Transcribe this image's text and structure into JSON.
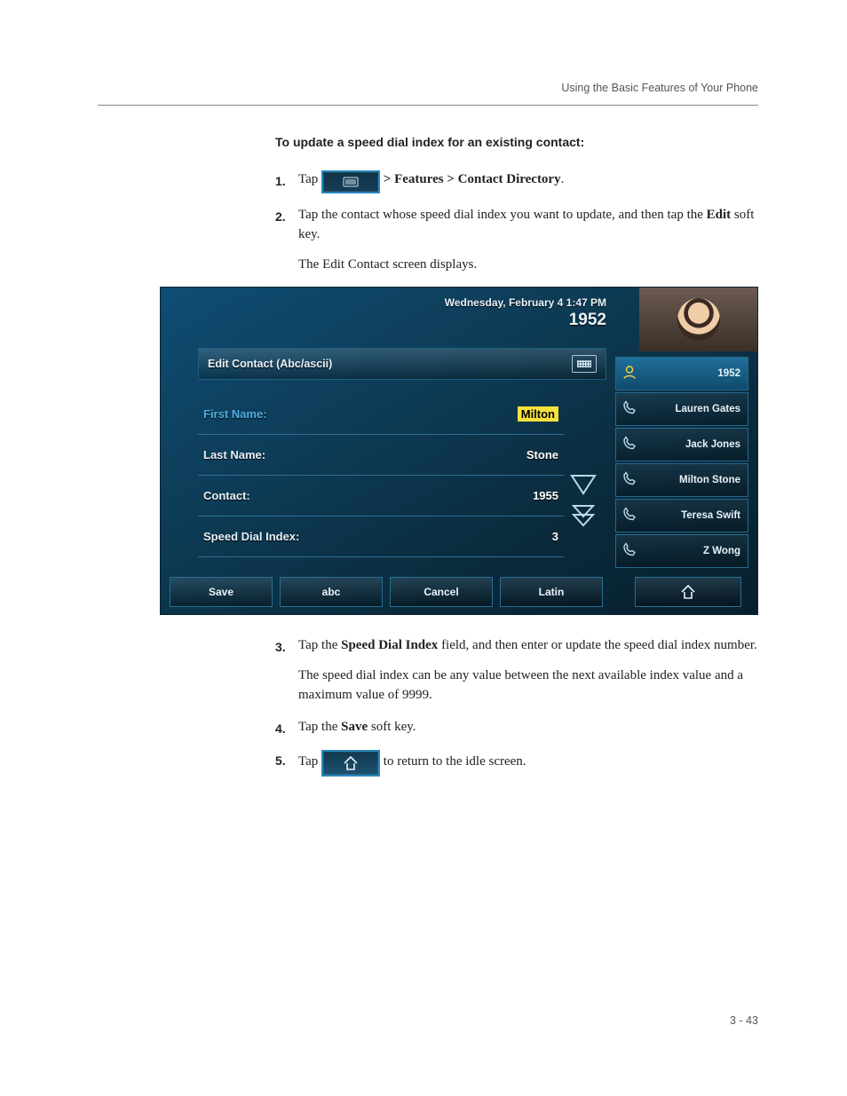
{
  "header": {
    "running": "Using the Basic Features of Your Phone"
  },
  "heading": "To update a speed dial index for an existing contact:",
  "steps": {
    "1": {
      "prefix": "Tap ",
      "suffix_bold": "  >  Features  >  Contact Directory",
      "period": "."
    },
    "2": {
      "line1_a": "Tap the contact whose speed dial index you want to update, and then tap the ",
      "line1_b_bold": "Edit",
      "line1_c": " soft key.",
      "line2": "The Edit Contact screen displays."
    },
    "3": {
      "line1_a": "Tap the ",
      "line1_b_bold": "Speed Dial Index",
      "line1_c": " field, and then enter or update the speed dial index number.",
      "line2": "The speed dial index can be any value between the next available index value and a maximum value of 9999."
    },
    "4": {
      "a": "Tap the ",
      "b_bold": "Save",
      "c": " soft key."
    },
    "5": {
      "a": "Tap ",
      "b": " to return to the idle screen."
    }
  },
  "screenshot": {
    "datetime": "Wednesday, February 4  1:47 PM",
    "extension": "1952",
    "title": "Edit Contact (Abc/ascii)",
    "fields": {
      "first_name": {
        "label": "First Name:",
        "value": "Milton"
      },
      "last_name": {
        "label": "Last Name:",
        "value": "Stone"
      },
      "contact": {
        "label": "Contact:",
        "value": "1955"
      },
      "speed_dial": {
        "label": "Speed Dial Index:",
        "value": "3"
      }
    },
    "contacts": [
      {
        "label": "1952",
        "primary": true
      },
      {
        "label": "Lauren Gates"
      },
      {
        "label": "Jack Jones"
      },
      {
        "label": "Milton Stone"
      },
      {
        "label": "Teresa Swift"
      },
      {
        "label": "Z Wong"
      }
    ],
    "softkeys": [
      "Save",
      "abc",
      "Cancel",
      "Latin"
    ]
  },
  "footer": {
    "page": "3 - 43"
  }
}
